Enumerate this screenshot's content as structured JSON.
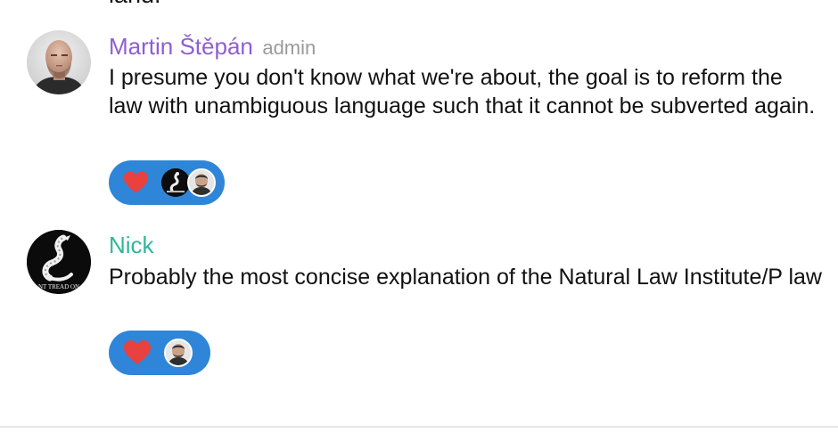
{
  "previous_message": {
    "tail_text": "land."
  },
  "messages": [
    {
      "author": "Martin Štěpán",
      "role": "admin",
      "author_color": "#8e5fd0",
      "text": "I presume you don't know what we're about, the goal is to reform the law with unambiguous language such that it cannot be subverted again.",
      "avatar_icon": "bald-man-photo-avatar",
      "reaction": {
        "emoji": "heart",
        "reactors": [
          "gadsden-flag-avatar",
          "man-photo-avatar"
        ]
      }
    },
    {
      "author": "Nick",
      "author_color": "#2fb89a",
      "text": "Probably the most concise explanation of the Natural Law Institute/P law",
      "avatar_icon": "gadsden-flag-avatar",
      "avatar_caption": "NT TREAD ON",
      "reaction": {
        "emoji": "heart",
        "reactors": [
          "man-photo-avatar"
        ]
      }
    }
  ],
  "colors": {
    "reaction_bg": "#2f86d8",
    "heart": "#e8413f",
    "text": "#111111",
    "role": "#9a9a9a"
  }
}
